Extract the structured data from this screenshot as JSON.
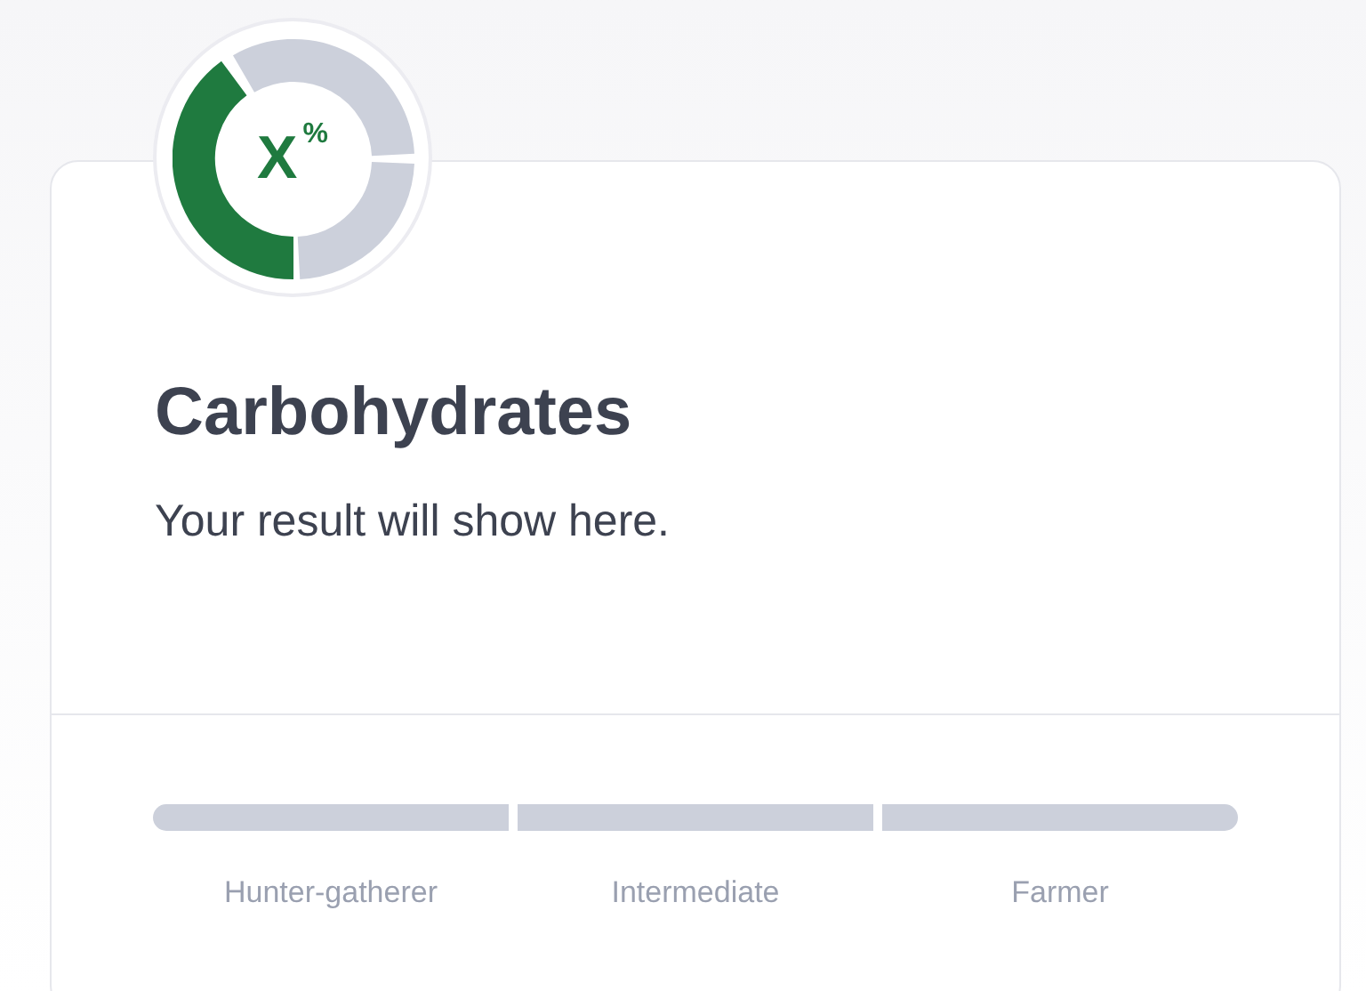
{
  "result_badge": {
    "value": "X",
    "unit": "%"
  },
  "title": "Carbohydrates",
  "message": "Your result will show here.",
  "scale": [
    {
      "label": "Hunter-gatherer",
      "selected": false
    },
    {
      "label": "Intermediate",
      "selected": false
    },
    {
      "label": "Farmer",
      "selected": false
    }
  ]
}
